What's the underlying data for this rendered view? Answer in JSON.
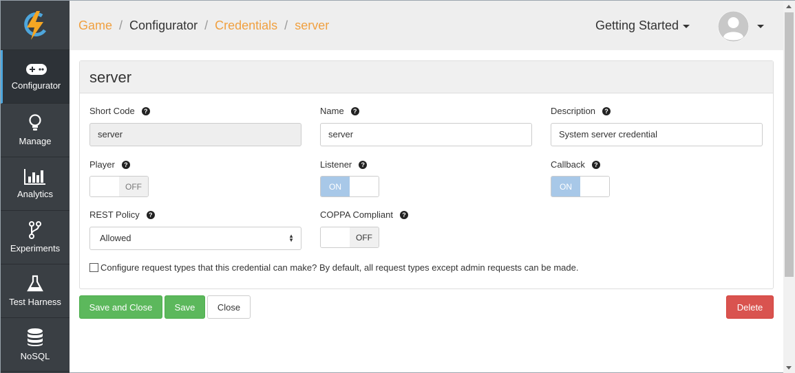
{
  "sidebar": {
    "items": [
      {
        "label": "Configurator",
        "icon": "gamepad-icon"
      },
      {
        "label": "Manage",
        "icon": "lightbulb-icon"
      },
      {
        "label": "Analytics",
        "icon": "bar-chart-icon"
      },
      {
        "label": "Experiments",
        "icon": "branch-icon"
      },
      {
        "label": "Test Harness",
        "icon": "flask-icon"
      },
      {
        "label": "NoSQL",
        "icon": "database-icon"
      }
    ]
  },
  "breadcrumb": {
    "game": "Game",
    "configurator": "Configurator",
    "credentials": "Credentials",
    "server": "server",
    "sep": "/"
  },
  "header": {
    "getting_started": "Getting Started"
  },
  "panel": {
    "title": "server"
  },
  "fields": {
    "short_code": {
      "label": "Short Code",
      "value": "server"
    },
    "name": {
      "label": "Name",
      "value": "server"
    },
    "description": {
      "label": "Description",
      "value": "System server credential"
    },
    "player": {
      "label": "Player",
      "state": "OFF"
    },
    "listener": {
      "label": "Listener",
      "state": "ON"
    },
    "callback": {
      "label": "Callback",
      "state": "ON"
    },
    "rest_policy": {
      "label": "REST Policy",
      "value": "Allowed"
    },
    "coppa": {
      "label": "COPPA Compliant",
      "state": "OFF"
    },
    "request_types": {
      "label": "Configure request types that this credential can make? By default, all request types except admin requests can be made."
    }
  },
  "help_glyph": "?",
  "buttons": {
    "save_close": "Save and Close",
    "save": "Save",
    "close": "Close",
    "delete": "Delete"
  },
  "colors": {
    "accent": "#f0a040",
    "sidebar": "#3a3f44",
    "green": "#5cb85c",
    "red": "#d9534f",
    "toggle_on": "#a8c8e8"
  }
}
